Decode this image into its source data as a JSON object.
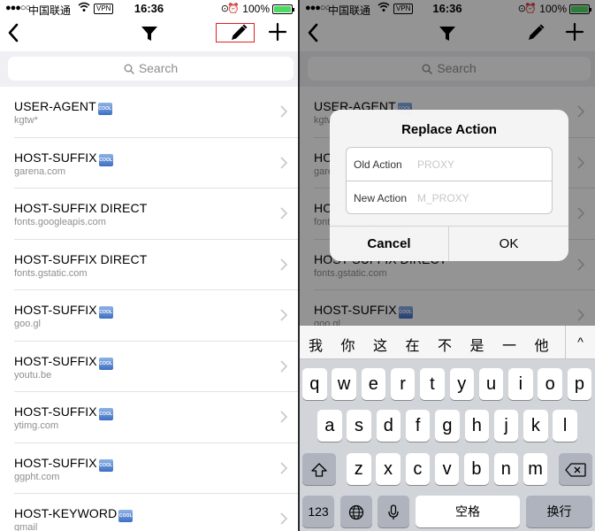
{
  "left_screen": {
    "status": {
      "carrier": "中国联通",
      "vpn": "VPN",
      "time": "16:36",
      "battery_pct": "100%"
    },
    "search": {
      "placeholder": "Search"
    },
    "badge_text": "COOL",
    "rules": [
      {
        "title": "USER-AGENT",
        "badge": true,
        "sub": "kgtw*"
      },
      {
        "title": "HOST-SUFFIX",
        "badge": true,
        "sub": "garena.com"
      },
      {
        "title": "HOST-SUFFIX DIRECT",
        "badge": false,
        "sub": "fonts.googleapis.com"
      },
      {
        "title": "HOST-SUFFIX DIRECT",
        "badge": false,
        "sub": "fonts.gstatic.com"
      },
      {
        "title": "HOST-SUFFIX",
        "badge": true,
        "sub": "goo.gl"
      },
      {
        "title": "HOST-SUFFIX",
        "badge": true,
        "sub": "youtu.be"
      },
      {
        "title": "HOST-SUFFIX",
        "badge": true,
        "sub": "ytimg.com"
      },
      {
        "title": "HOST-SUFFIX",
        "badge": true,
        "sub": "ggpht.com"
      },
      {
        "title": "HOST-KEYWORD",
        "badge": true,
        "sub": "gmail"
      }
    ]
  },
  "right_screen": {
    "status": {
      "carrier": "中国联通",
      "vpn": "VPN",
      "time": "16:36",
      "battery_pct": "100%"
    },
    "search": {
      "placeholder": "Search"
    },
    "rules": [
      {
        "title": "USER-AGENT",
        "badge": true,
        "sub": "kgtw*"
      },
      {
        "title": "HOST-SUFFIX",
        "badge": true,
        "sub": "garena.com"
      },
      {
        "title": "HOST-SUFFIX DIRECT",
        "badge": false,
        "sub": "fonts.googleapis.com"
      },
      {
        "title": "HOST-SUFFIX DIRECT",
        "badge": false,
        "sub": "fonts.gstatic.com"
      },
      {
        "title": "HOST-SUFFIX",
        "badge": true,
        "sub": "goo.gl"
      }
    ],
    "alert": {
      "title": "Replace Action",
      "old_label": "Old Action",
      "old_placeholder": "PROXY",
      "new_label": "New Action",
      "new_placeholder": "M_PROXY",
      "cancel": "Cancel",
      "ok": "OK"
    },
    "keyboard": {
      "candidates": [
        "我",
        "你",
        "这",
        "在",
        "不",
        "是",
        "一",
        "他"
      ],
      "row1": [
        "q",
        "w",
        "e",
        "r",
        "t",
        "y",
        "u",
        "i",
        "o",
        "p"
      ],
      "row2": [
        "a",
        "s",
        "d",
        "f",
        "g",
        "h",
        "j",
        "k",
        "l"
      ],
      "row3": [
        "z",
        "x",
        "c",
        "v",
        "b",
        "n",
        "m"
      ],
      "numbers_key": "123",
      "space_key": "空格",
      "return_key": "换行"
    }
  },
  "colors": {
    "highlight_box": "#e02020",
    "nav_bg": "#ffffff",
    "search_bg": "#efeff4",
    "subtitle": "#8e8e93"
  }
}
